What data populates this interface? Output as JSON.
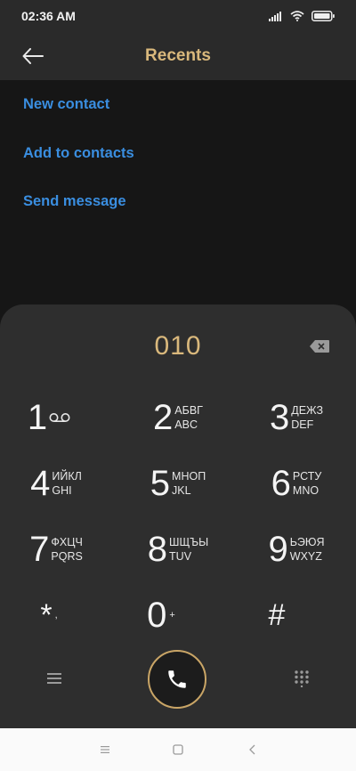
{
  "status": {
    "time": "02:36 AM"
  },
  "header": {
    "title": "Recents"
  },
  "actions": [
    "New contact",
    "Add to contacts",
    "Send message"
  ],
  "dialer": {
    "number": "010",
    "keys": [
      {
        "digit": "1",
        "sub1": "",
        "sub2": ""
      },
      {
        "digit": "2",
        "sub1": "АБВГ",
        "sub2": "ABC"
      },
      {
        "digit": "3",
        "sub1": "ДЕЖЗ",
        "sub2": "DEF"
      },
      {
        "digit": "4",
        "sub1": "ИЙКЛ",
        "sub2": "GHI"
      },
      {
        "digit": "5",
        "sub1": "МНОП",
        "sub2": "JKL"
      },
      {
        "digit": "6",
        "sub1": "РСТУ",
        "sub2": "MNO"
      },
      {
        "digit": "7",
        "sub1": "ФХЦЧ",
        "sub2": "PQRS"
      },
      {
        "digit": "8",
        "sub1": "ШЩЪЫ",
        "sub2": "TUV"
      },
      {
        "digit": "9",
        "sub1": "ЬЭЮЯ",
        "sub2": "WXYZ"
      },
      {
        "digit": "*",
        "sub1": ",",
        "sub2": ""
      },
      {
        "digit": "0",
        "sub1": "+",
        "sub2": ""
      },
      {
        "digit": "#",
        "sub1": "",
        "sub2": ""
      }
    ]
  },
  "colors": {
    "accent": "#d9b87c",
    "link": "#3a8ee0",
    "background": "#161616",
    "dialer": "#2e2e2e"
  },
  "icons": {
    "back": "arrow-left-icon",
    "backspace": "backspace-icon",
    "voicemail": "voicemail-icon",
    "menu": "menu-icon",
    "call": "phone-icon",
    "keypad": "keypad-icon"
  }
}
